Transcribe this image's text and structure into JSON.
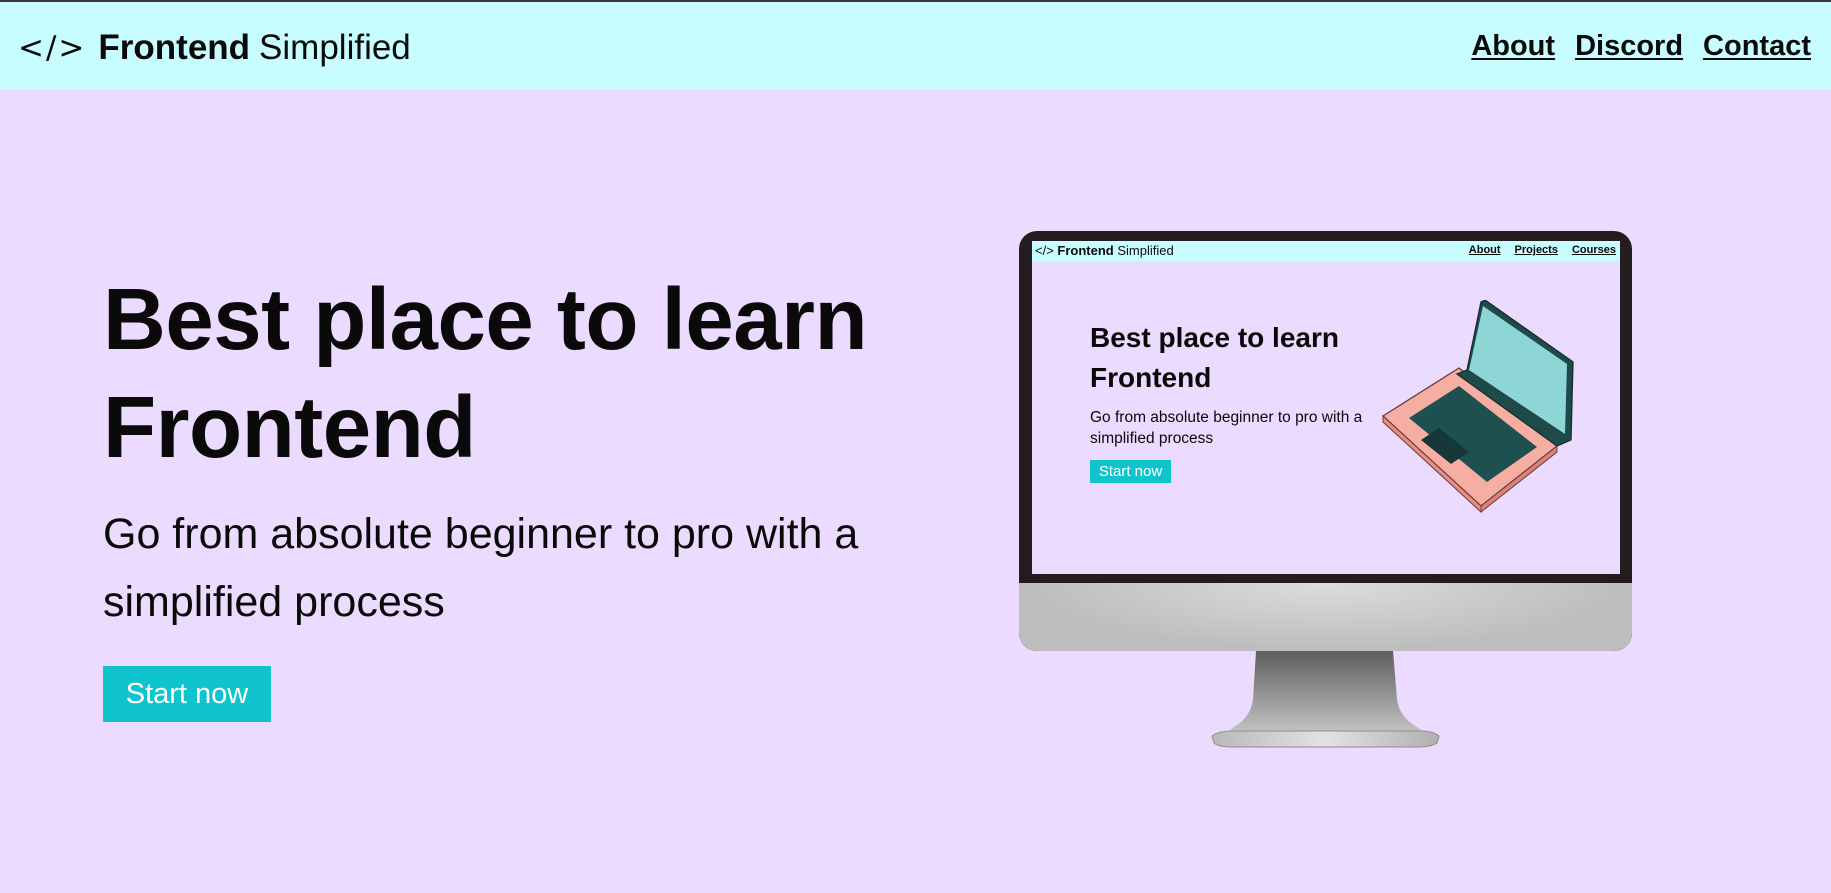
{
  "navbar": {
    "logo_icon": "</>",
    "brand_bold": "Frontend",
    "brand_light": "Simplified",
    "links": [
      {
        "label": "About"
      },
      {
        "label": "Discord"
      },
      {
        "label": "Contact"
      }
    ]
  },
  "hero": {
    "title_line1": "Best place to learn",
    "title_line2": "Frontend",
    "subtitle_line1": "Go from absolute beginner to pro with a",
    "subtitle_line2": "simplified process",
    "cta_label": "Start now"
  },
  "illustration": {
    "icon": "desktop-monitor-icon",
    "screen": {
      "logo_icon": "</>",
      "brand_bold": "Frontend",
      "brand_light": "Simplified",
      "links": [
        "About",
        "Projects",
        "Courses"
      ],
      "title_line1": "Best place to learn",
      "title_line2": "Frontend",
      "subtitle_line1": "Go from absolute beginner to pro with a",
      "subtitle_line2": "simplified process",
      "cta_label": "Start now",
      "art_icon": "laptop-icon"
    }
  },
  "colors": {
    "navbar_bg": "#c7fdff",
    "page_bg": "#ebdbff",
    "accent": "#0fc4cc",
    "text": "#0a0a0a"
  }
}
